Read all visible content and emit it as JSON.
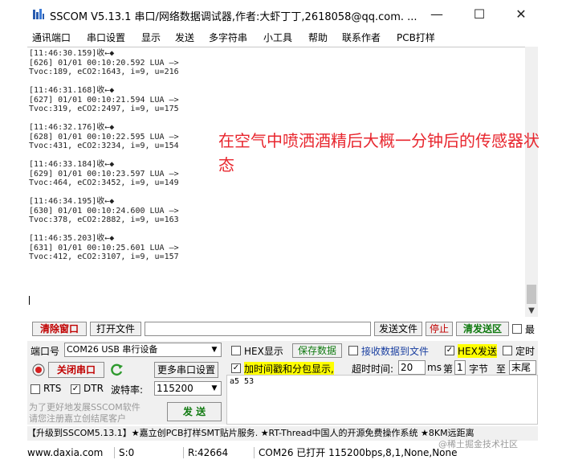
{
  "window": {
    "title": "SSCOM V5.13.1 串口/网络数据调试器,作者:大虾丁丁,2618058@qq.com. ...",
    "minimize": "—",
    "maximize": "☐",
    "close": "✕"
  },
  "menu": [
    "通讯端口",
    "串口设置",
    "显示",
    "发送",
    "多字符串",
    "小工具",
    "帮助",
    "联系作者",
    "PCB打样"
  ],
  "receive": {
    "lines": [
      "[11:46:30.159]收←◆",
      "[626] 01/01 00:10:20.592 LUA —>",
      "Tvoc:189, eCO2:1643, i=9, u=216",
      "",
      "[11:46:31.168]收←◆",
      "[627] 01/01 00:10:21.594 LUA —>",
      "Tvoc:319, eCO2:2497, i=9, u=175",
      "",
      "[11:46:32.176]收←◆",
      "[628] 01/01 00:10:22.595 LUA —>",
      "Tvoc:431, eCO2:3234, i=9, u=154",
      "",
      "[11:46:33.184]收←◆",
      "[629] 01/01 00:10:23.597 LUA —>",
      "Tvoc:464, eCO2:3452, i=9, u=149",
      "",
      "[11:46:34.195]收←◆",
      "[630] 01/01 00:10:24.600 LUA —>",
      "Tvoc:378, eCO2:2882, i=9, u=163",
      "",
      "[11:46:35.203]收←◆",
      "[631] 01/01 00:10:25.601 LUA —>",
      "Tvoc:412, eCO2:3107, i=9, u=157"
    ],
    "annotation": "在空气中喷洒酒精后大概一分钟后的传感器状态"
  },
  "toolbar": {
    "clear_window": "清除窗口",
    "open_file": "打开文件",
    "send_file": "发送文件",
    "stop": "停止",
    "clear_send": "清发送区",
    "last": "最"
  },
  "port": {
    "label": "端口号",
    "value": "COM26 USB 串行设备",
    "close_port": "关闭串口",
    "more_settings": "更多串口设置",
    "rts": "RTS",
    "dtr": "DTR",
    "baud_label": "波特率:",
    "baud_value": "115200",
    "promo_line1": "为了更好地发展SSCOM软件",
    "promo_line2": "请您注册嘉立创结尾客户",
    "send": "发 送"
  },
  "options": {
    "hex_display": "HEX显示",
    "save_data": "保存数据",
    "recv_to_file": "接收数据到文件",
    "hex_send": "HEX发送",
    "timed": "定时",
    "timestamp": "加时间戳和分包显示,",
    "timeout_label": "超时时间:",
    "timeout_value": "20",
    "ms": "ms",
    "page_label": "第",
    "page_value": "1",
    "byte_label": "字节",
    "to_label": "至",
    "end_label": "末尾"
  },
  "send_text": "a5 53",
  "ad_text": "【升级到SSCOM5.13.1】★嘉立创PCB打样SMT贴片服务. ★RT-Thread中国人的开源免费操作系统 ★8KM远距离",
  "status": {
    "site": "www.daxia.com",
    "s": "S:0",
    "r": "R:42664",
    "port_state": "COM26 已打开  115200bps,8,1,None,None"
  },
  "watermark": "@稀土掘金技术社区",
  "colors": {
    "annotation": "#e8262e",
    "hex_send_highlight": "#ffff00",
    "timestamp_highlight": "#ffff00"
  }
}
